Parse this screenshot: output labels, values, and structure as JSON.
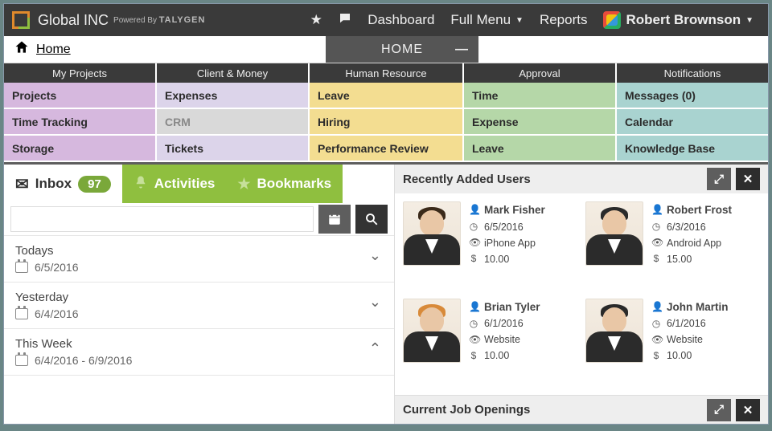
{
  "header": {
    "brand": "Global INC",
    "powered_prefix": "Powered By ",
    "powered_brand": "TALYGEN",
    "nav": {
      "dashboard": "Dashboard",
      "full_menu": "Full Menu",
      "reports": "Reports"
    },
    "user_name": "Robert Brownson"
  },
  "breadcrumb": {
    "home": "Home"
  },
  "home_tab": {
    "label": "HOME"
  },
  "categories": [
    "My Projects",
    "Client & Money",
    "Human Resource",
    "Approval",
    "Notifications"
  ],
  "tiles": [
    [
      "Projects",
      "Expenses",
      "Leave",
      "Time",
      "Messages (0)"
    ],
    [
      "Time Tracking",
      "CRM",
      "Hiring",
      "Expense",
      "Calendar"
    ],
    [
      "Storage",
      "Tickets",
      "Performance Review",
      "Leave",
      "Knowledge Base"
    ]
  ],
  "left_tabs": {
    "inbox_label": "Inbox",
    "inbox_count": "97",
    "activities": "Activities",
    "bookmarks": "Bookmarks"
  },
  "accordion": [
    {
      "title": "Todays",
      "sub": "6/5/2016",
      "open": false
    },
    {
      "title": "Yesterday",
      "sub": "6/4/2016",
      "open": false
    },
    {
      "title": "This Week",
      "sub": "6/4/2016 - 6/9/2016",
      "open": true
    }
  ],
  "panels": {
    "recent_users": "Recently Added Users",
    "job_openings": "Current Job Openings"
  },
  "users": [
    {
      "name": "Mark Fisher",
      "date": "6/5/2016",
      "source": "iPhone App",
      "amount": "10.00",
      "hair": "#3b2a1a"
    },
    {
      "name": "Robert Frost",
      "date": "6/3/2016",
      "source": "Android App",
      "amount": "15.00",
      "hair": "#2a2a2a"
    },
    {
      "name": "Brian Tyler",
      "date": "6/1/2016",
      "source": "Website",
      "amount": "10.00",
      "hair": "#d88a3a"
    },
    {
      "name": "John Martin",
      "date": "6/1/2016",
      "source": "Website",
      "amount": "10.00",
      "hair": "#2a2a2a"
    }
  ]
}
